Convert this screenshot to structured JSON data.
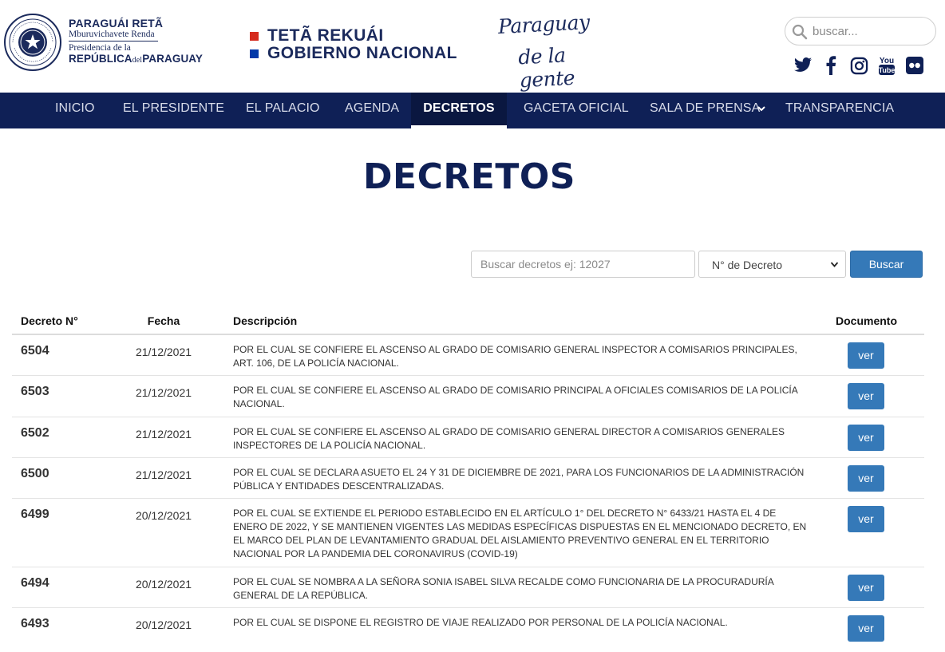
{
  "header": {
    "presidency": {
      "title": "PARAGUÁI RETÃ",
      "subtitle": "Mburuvichavete Renda",
      "pre": "Presidencia de la",
      "rep_a": "REPÚBLICA",
      "rep_del": "del",
      "rep_b": "PARAGUAY"
    },
    "government": {
      "line1": "TETÃ REKUÁI",
      "line2": "GOBIERNO NACIONAL"
    },
    "campaign": {
      "line1": "Paraguay",
      "line2": "de la gente"
    },
    "search_placeholder": "buscar...",
    "social": [
      "twitter-icon",
      "facebook-icon",
      "instagram-icon",
      "youtube-icon",
      "flickr-icon"
    ]
  },
  "nav": {
    "items": [
      {
        "label": "INICIO"
      },
      {
        "label": "EL PRESIDENTE"
      },
      {
        "label": "EL PALACIO"
      },
      {
        "label": "AGENDA"
      },
      {
        "label": "DECRETOS",
        "active": true
      },
      {
        "label": "GACETA OFICIAL"
      },
      {
        "label": "SALA DE PRENSA",
        "has_dropdown": true
      },
      {
        "label": "TRANSPARENCIA"
      }
    ]
  },
  "page": {
    "title": "DECRETOS"
  },
  "filter": {
    "search_placeholder": "Buscar decretos ej: 12027",
    "select_value": "N° de Decreto",
    "button_label": "Buscar"
  },
  "table": {
    "headers": {
      "number": "Decreto N°",
      "date": "Fecha",
      "description": "Descripción",
      "document": "Documento"
    },
    "rows": [
      {
        "number": "6504",
        "date": "21/12/2021",
        "description": "POR EL CUAL SE CONFIERE EL ASCENSO AL GRADO DE COMISARIO GENERAL INSPECTOR A COMISARIOS PRINCIPALES, ART. 106, DE LA POLICÍA NACIONAL.",
        "doc": "ver"
      },
      {
        "number": "6503",
        "date": "21/12/2021",
        "description": "POR EL CUAL SE CONFIERE EL ASCENSO AL GRADO DE COMISARIO PRINCIPAL A OFICIALES COMISARIOS DE LA POLICÍA NACIONAL.",
        "doc": "ver"
      },
      {
        "number": "6502",
        "date": "21/12/2021",
        "description": "POR EL CUAL SE CONFIERE EL ASCENSO AL GRADO DE COMISARIO GENERAL DIRECTOR A COMISARIOS GENERALES INSPECTORES DE LA POLICÍA NACIONAL.",
        "doc": "ver"
      },
      {
        "number": "6500",
        "date": "21/12/2021",
        "description": "POR EL CUAL SE DECLARA ASUETO EL 24 Y 31 DE DICIEMBRE DE 2021, PARA LOS FUNCIONARIOS DE LA ADMINISTRACIÓN PÚBLICA Y ENTIDADES DESCENTRALIZADAS.",
        "doc": "ver"
      },
      {
        "number": "6499",
        "date": "20/12/2021",
        "description": "POR EL CUAL SE EXTIENDE EL PERIODO ESTABLECIDO EN EL ARTÍCULO 1° DEL DECRETO N° 6433/21 HASTA EL 4 DE ENERO DE 2022, Y SE MANTIENEN VIGENTES LAS MEDIDAS ESPECÍFICAS DISPUESTAS EN EL MENCIONADO DECRETO, EN EL MARCO DEL PLAN DE LEVANTAMIENTO GRADUAL DEL AISLAMIENTO PREVENTIVO GENERAL EN EL TERRITORIO NACIONAL POR LA PANDEMIA DEL CORONAVIRUS (COVID-19)",
        "doc": "ver"
      },
      {
        "number": "6494",
        "date": "20/12/2021",
        "description": "POR EL CUAL SE NOMBRA A LA SEÑORA SONIA ISABEL SILVA RECALDE COMO FUNCIONARIA DE LA PROCURADURÍA GENERAL DE LA REPÚBLICA.",
        "doc": "ver"
      },
      {
        "number": "6493",
        "date": "20/12/2021",
        "description": "POR EL CUAL SE DISPONE EL REGISTRO DE VIAJE REALIZADO POR PERSONAL DE LA POLICÍA NACIONAL.",
        "doc": "ver"
      }
    ]
  },
  "colors": {
    "navy": "#0f2056",
    "accent_blue": "#3579b8",
    "flag_red": "#d52b1e",
    "flag_blue": "#0038a8"
  }
}
